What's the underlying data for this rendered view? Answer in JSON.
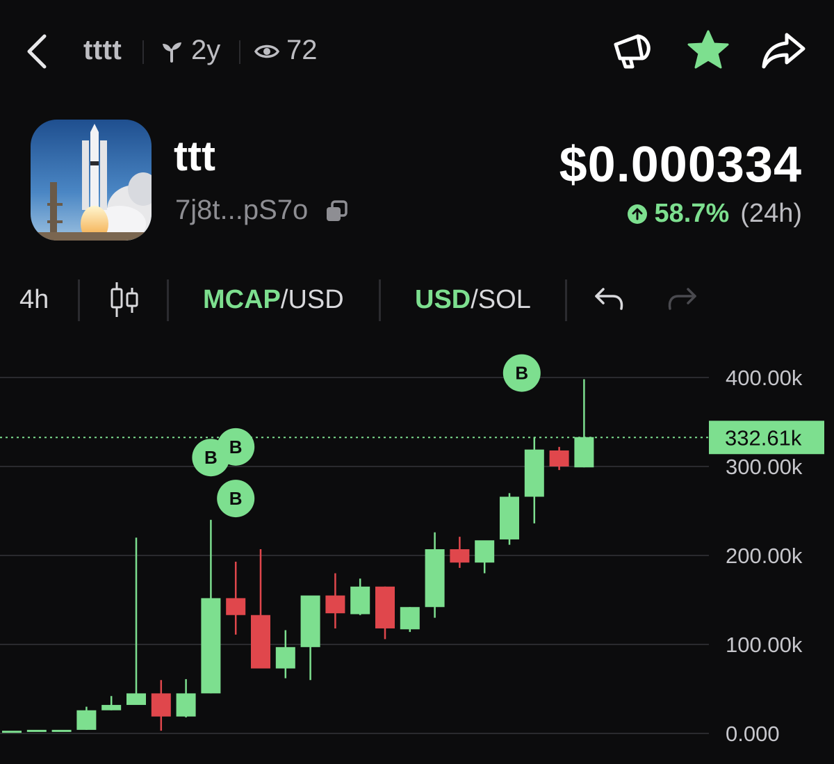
{
  "nav": {
    "symbol": "tttt",
    "age": "2y",
    "views": "72"
  },
  "token": {
    "name": "ttt",
    "address": "7j8t...pS7o",
    "price": "$0.000334",
    "change_pct": "58.7%",
    "change_period": "(24h)"
  },
  "toolbar": {
    "interval": "4h",
    "mcap_selected": "MCAP",
    "mcap_rest": "/USD",
    "usd_selected": "USD",
    "usd_rest": "/SOL"
  },
  "colors": {
    "up": "#7ddf8f",
    "down": "#e0474c",
    "background": "#0c0c0d"
  },
  "icons": [
    "back-arrow-icon",
    "sprout-icon",
    "eye-icon",
    "megaphone-icon",
    "star-icon",
    "share-icon",
    "copy-icon",
    "arrow-up-circle-icon",
    "candlestick-icon",
    "undo-icon",
    "redo-icon"
  ],
  "chart_data": {
    "type": "candlestick",
    "y_ticks": [
      "400.00k",
      "300.00k",
      "200.00k",
      "100.00k",
      "0.000"
    ],
    "ylim": [
      0,
      400000
    ],
    "current_value": 332610,
    "current_label": "332.61k",
    "grid": true,
    "candles": [
      {
        "o": 3000,
        "h": 3000,
        "l": 3000,
        "c": 3000
      },
      {
        "o": 3000,
        "h": 3000,
        "l": 3000,
        "c": 4000
      },
      {
        "o": 4000,
        "h": 4000,
        "l": 4000,
        "c": 4000
      },
      {
        "o": 4000,
        "h": 30000,
        "l": 4000,
        "c": 26000
      },
      {
        "o": 26000,
        "h": 42000,
        "l": 26000,
        "c": 32000
      },
      {
        "o": 32000,
        "h": 220000,
        "l": 32000,
        "c": 45000
      },
      {
        "o": 45000,
        "h": 60000,
        "l": 3000,
        "c": 19000
      },
      {
        "o": 19000,
        "h": 61000,
        "l": 18000,
        "c": 45000
      },
      {
        "o": 45000,
        "h": 240000,
        "l": 45000,
        "c": 152000
      },
      {
        "o": 152000,
        "h": 193000,
        "l": 111000,
        "c": 133000
      },
      {
        "o": 133000,
        "h": 207000,
        "l": 73000,
        "c": 73000
      },
      {
        "o": 73000,
        "h": 116000,
        "l": 62000,
        "c": 97000
      },
      {
        "o": 97000,
        "h": 154000,
        "l": 60000,
        "c": 155000
      },
      {
        "o": 155000,
        "h": 180000,
        "l": 118000,
        "c": 135000
      },
      {
        "o": 134000,
        "h": 174000,
        "l": 133000,
        "c": 165000
      },
      {
        "o": 165000,
        "h": 165000,
        "l": 106000,
        "c": 118000
      },
      {
        "o": 117000,
        "h": 142000,
        "l": 114000,
        "c": 142000
      },
      {
        "o": 142000,
        "h": 226000,
        "l": 130000,
        "c": 207000
      },
      {
        "o": 207000,
        "h": 221000,
        "l": 186000,
        "c": 192000
      },
      {
        "o": 192000,
        "h": 216000,
        "l": 180000,
        "c": 217000
      },
      {
        "o": 218000,
        "h": 270000,
        "l": 212000,
        "c": 266000
      },
      {
        "o": 266000,
        "h": 333000,
        "l": 236000,
        "c": 319000
      },
      {
        "o": 318000,
        "h": 322000,
        "l": 296000,
        "c": 300000
      },
      {
        "o": 299000,
        "h": 398000,
        "l": 299000,
        "c": 333000
      }
    ],
    "buy_markers": [
      {
        "candle": 8,
        "label": "B",
        "value": 310000
      },
      {
        "candle": 9,
        "label": "B",
        "value": 322000
      },
      {
        "candle": 9,
        "label": "B",
        "value": 264000
      },
      {
        "candle": 21,
        "label": "B",
        "value": 405000
      }
    ]
  }
}
